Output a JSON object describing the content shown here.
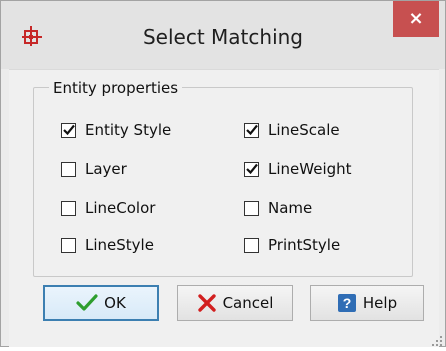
{
  "window": {
    "title": "Select Matching",
    "close_label": "×"
  },
  "group": {
    "label": "Entity properties"
  },
  "checkboxes": [
    {
      "label": "Entity Style",
      "checked": true
    },
    {
      "label": "LineScale",
      "checked": true
    },
    {
      "label": "Layer",
      "checked": false
    },
    {
      "label": "LineWeight",
      "checked": true
    },
    {
      "label": "LineColor",
      "checked": false
    },
    {
      "label": "Name",
      "checked": false
    },
    {
      "label": "LineStyle",
      "checked": false
    },
    {
      "label": "PrintStyle",
      "checked": false
    }
  ],
  "buttons": {
    "ok": "OK",
    "cancel": "Cancel",
    "help": "Help"
  },
  "colors": {
    "close_bg": "#c75050",
    "check_mark": "#111111",
    "ok_check": "#2e9e2e",
    "cancel_x": "#d21f1f",
    "help_icon": "#2f6db5",
    "app_icon": "#c62828"
  }
}
